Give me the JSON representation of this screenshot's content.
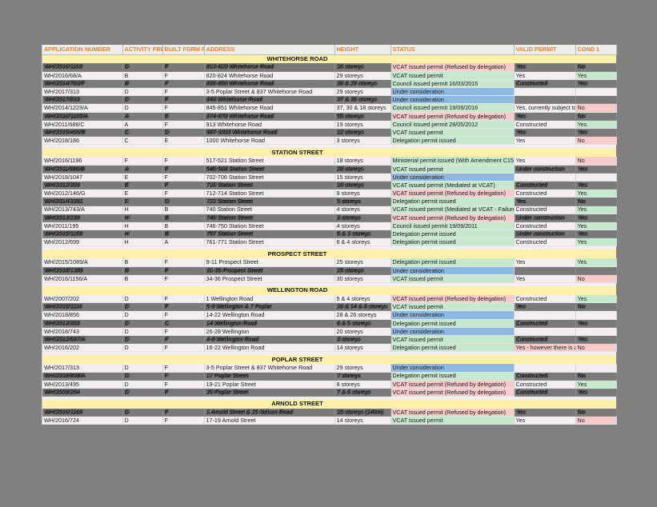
{
  "app": {
    "background_color": "#808080",
    "sheet_background": "#ffffff"
  },
  "table": {
    "headers": [
      "APPLICATION NUMBER",
      "ACTIVITY PRE",
      "BUILT FORM PR",
      "ADDRESS",
      "HEIGHT",
      "STATUS",
      "VALID PERMIT",
      "COND 1"
    ],
    "colors": {
      "header_text": "#ED7D31",
      "header_fill": "#ECEEE9",
      "section_fill": "#FDF0A8",
      "green": "#C6E8CD",
      "pink": "#F8CBCB",
      "blue": "#8DB9E2",
      "row_fill": "#F3EEF1",
      "glitch_fill": "#7A7A7A"
    },
    "sections": [
      {
        "name": "WHITEHORSE ROAD",
        "rows": [
          {
            "app": "WH/2016/1109",
            "activity": "D",
            "built": "F",
            "address": "813-829 Whitehorse Road",
            "height": "16 storeys",
            "status": "VCAT issued permit (Refused by delegation)",
            "status_color": "pink",
            "valid": "Yes",
            "valid_color": "plain",
            "cond": "No",
            "cond_color": "pink",
            "glitch": true
          },
          {
            "app": "WH/2016/68/A",
            "activity": "B",
            "built": "F",
            "address": "820-824 Whitehorse Road",
            "height": "29 storeys",
            "status": "VCAT issued permit",
            "status_color": "green",
            "valid": "Yes",
            "valid_color": "plain",
            "cond": "Yes",
            "cond_color": "green",
            "glitch": false
          },
          {
            "app": "WH/2014/763/F",
            "activity": "B",
            "built": "F",
            "address": "836-850 Whitehorse Road",
            "height": "36 & 29 storeys",
            "status": "Council issued permit 16/03/2015",
            "status_color": "green",
            "valid": "Constructed",
            "valid_color": "plain",
            "cond": "Yes",
            "cond_color": "green",
            "glitch": true
          },
          {
            "app": "WH/2017/313",
            "activity": "D",
            "built": "F",
            "address": "3-5 Poplar Street & 837 Whitehorse Road",
            "height": "29 storeys",
            "status": "Under consideration",
            "status_color": "blue",
            "valid": "",
            "valid_color": "plain",
            "cond": "",
            "cond_color": "plain",
            "glitch": false
          },
          {
            "app": "WH/2017/819",
            "activity": "D",
            "built": "F",
            "address": "843 Whitehorse Road",
            "height": "37 & 36 storeys",
            "status": "Under consideration",
            "status_color": "blue",
            "valid": "",
            "valid_color": "plain",
            "cond": "",
            "cond_color": "plain",
            "glitch": true
          },
          {
            "app": "WH/2014/1223/A",
            "activity": "D",
            "built": "F",
            "address": "845-851 Whitehorse Road",
            "height": "37, 30 & 18 storeys",
            "status": "Council issued permit 19/09/2016",
            "status_color": "green",
            "valid": "Yes, currently subject to a",
            "valid_color": "plain",
            "cond": "No",
            "cond_color": "pink",
            "glitch": false
          },
          {
            "app": "WH/2016/1105/A",
            "activity": "A",
            "built": "E",
            "address": "874-878 Whitehorse Road",
            "height": "55 storeys",
            "status": "VCAT issued permit (Refused by delegation)",
            "status_color": "pink",
            "valid": "Yes",
            "valid_color": "plain",
            "cond": "No",
            "cond_color": "pink",
            "glitch": true
          },
          {
            "app": "WH/2011/688/C",
            "activity": "A",
            "built": "F",
            "address": "913 Whitehorse Road",
            "height": "19 storeys",
            "status": "Council issued permit 28/05/2012",
            "status_color": "green",
            "valid": "Constructed",
            "valid_color": "plain",
            "cond": "Yes",
            "cond_color": "green",
            "glitch": false
          },
          {
            "app": "WH/2015/406/B",
            "activity": "C",
            "built": "D",
            "address": "987-1003 Whitehorse Road",
            "height": "12 storeys",
            "status": "VCAT issued permit",
            "status_color": "green",
            "valid": "Yes",
            "valid_color": "plain",
            "cond": "Yes",
            "cond_color": "green",
            "glitch": true
          },
          {
            "app": "WH/2018/186",
            "activity": "C",
            "built": "E",
            "address": "1000 Whitehorse Road",
            "height": "3 storeys",
            "status": "Delegation permit issued",
            "status_color": "green",
            "valid": "Yes",
            "valid_color": "plain",
            "cond": "No",
            "cond_color": "pink",
            "glitch": false
          }
        ]
      },
      {
        "name": "STATION STREET",
        "rows": [
          {
            "app": "WH/2016/1196",
            "activity": "F",
            "built": "F",
            "address": "517-521 Station Street",
            "height": "18 storeys",
            "status": "Ministerial permit issued (With Amendment C15",
            "status_color": "green",
            "valid": "Yes",
            "valid_color": "plain",
            "cond": "No",
            "cond_color": "pink",
            "glitch": false
          },
          {
            "app": "WH/2011/986/B",
            "activity": "A",
            "built": "F",
            "address": "545-568 Station Street",
            "height": "28 storeys",
            "status": "VCAT issued permit",
            "status_color": "green",
            "valid": "Under construction",
            "valid_color": "plain",
            "cond": "Yes",
            "cond_color": "green",
            "glitch": true
          },
          {
            "app": "WH/2018/1047",
            "activity": "E",
            "built": "F",
            "address": "702-706 Station Street",
            "height": "15 storeys",
            "status": "Under consideration",
            "status_color": "blue",
            "valid": "",
            "valid_color": "plain",
            "cond": "",
            "cond_color": "plain",
            "glitch": false
          },
          {
            "app": "WH/2012/309",
            "activity": "E",
            "built": "F",
            "address": "710 Station Street",
            "height": "10 storeys",
            "status": "VCAT issued permit (Mediated at VCAT)",
            "status_color": "green",
            "valid": "Constructed",
            "valid_color": "plain",
            "cond": "Yes",
            "cond_color": "green",
            "glitch": true
          },
          {
            "app": "WH/2012/146/G",
            "activity": "E",
            "built": "F",
            "address": "712-714 Station Street",
            "height": "9 storeys",
            "status": "VCAT issued permit (Refused by delegation)",
            "status_color": "pink",
            "valid": "Constructed",
            "valid_color": "plain",
            "cond": "Yes",
            "cond_color": "green",
            "glitch": false
          },
          {
            "app": "WH/2014/1061",
            "activity": "E",
            "built": "D",
            "address": "722 Station Street",
            "height": "5 storeys",
            "status": "Delegation permit issued",
            "status_color": "green",
            "valid": "Yes",
            "valid_color": "plain",
            "cond": "No",
            "cond_color": "pink",
            "glitch": true
          },
          {
            "app": "WH/2013/743/A",
            "activity": "H",
            "built": "B",
            "address": "740 Station Street",
            "height": "4 storeys",
            "status": "VCAT issued permit (Mediated at VCAT - Failure",
            "status_color": "green",
            "valid": "Constructed",
            "valid_color": "plain",
            "cond": "Yes",
            "cond_color": "green",
            "glitch": false
          },
          {
            "app": "WH/2013/239",
            "activity": "H",
            "built": "B",
            "address": "740 Station Street",
            "height": "3 storeys",
            "status": "VCAT issued permit (Refused by delegation)",
            "status_color": "pink",
            "valid": "Under construction",
            "valid_color": "plain",
            "cond": "Yes",
            "cond_color": "green",
            "glitch": true
          },
          {
            "app": "WH/2011/195",
            "activity": "H",
            "built": "B",
            "address": "746-750 Station Street",
            "height": "4 storeys",
            "status": "Council issued permit 19/09/2011",
            "status_color": "green",
            "valid": "Constructed",
            "valid_color": "plain",
            "cond": "Yes",
            "cond_color": "green",
            "glitch": false
          },
          {
            "app": "WH/2015/1159",
            "activity": "H",
            "built": "B",
            "address": "757 Station Street",
            "height": "5 & 3 storeys",
            "status": "Delegation permit issued",
            "status_color": "green",
            "valid": "Under construction",
            "valid_color": "plain",
            "cond": "Yes",
            "cond_color": "green",
            "glitch": true
          },
          {
            "app": "WH/2012/699",
            "activity": "H",
            "built": "A",
            "address": "761-771 Station Street",
            "height": "6 & 4 storeys",
            "status": "Delegation permit issued",
            "status_color": "green",
            "valid": "Constructed",
            "valid_color": "plain",
            "cond": "Yes",
            "cond_color": "green",
            "glitch": false
          }
        ]
      },
      {
        "name": "PROSPECT STREET",
        "rows": [
          {
            "app": "WH/2015/1089/A",
            "activity": "B",
            "built": "F",
            "address": "9-11 Prospect Street",
            "height": "25 storeys",
            "status": "Delegation permit issued",
            "status_color": "green",
            "valid": "Yes",
            "valid_color": "plain",
            "cond": "Yes",
            "cond_color": "green",
            "glitch": false
          },
          {
            "app": "WH/2018/1386",
            "activity": "B",
            "built": "F",
            "address": "31-35 Prospect Street",
            "height": "25 storeys",
            "status": "Under consideration",
            "status_color": "blue",
            "valid": "",
            "valid_color": "plain",
            "cond": "",
            "cond_color": "plain",
            "glitch": true
          },
          {
            "app": "WH/2016/1156/A",
            "activity": "B",
            "built": "F",
            "address": "34-36 Prospect Street",
            "height": "30 storeys",
            "status": "VCAT issued permit",
            "status_color": "green",
            "valid": "Yes",
            "valid_color": "plain",
            "cond": "No",
            "cond_color": "pink",
            "glitch": false
          }
        ]
      },
      {
        "name": "WELLINGTON ROAD",
        "rows": [
          {
            "app": "WH/2007/202",
            "activity": "D",
            "built": "F",
            "address": "1 Wellington Road",
            "height": "5 & 4 storeys",
            "status": "VCAT issued permit (Refused by delegation)",
            "status_color": "pink",
            "valid": "Constructed",
            "valid_color": "plain",
            "cond": "Yes",
            "cond_color": "green",
            "glitch": false
          },
          {
            "app": "WH/2015/1116",
            "activity": "D",
            "built": "F",
            "address": "5-9 Wellington & 7 Poplar",
            "height": "16 & 14 & 6 storeys",
            "status": "VCAT issued permit",
            "status_color": "green",
            "valid": "Yes",
            "valid_color": "plain",
            "cond": "No",
            "cond_color": "pink",
            "glitch": true
          },
          {
            "app": "WH/2018/856",
            "activity": "D",
            "built": "F",
            "address": "14-22 Wellington Road",
            "height": "28 & 26 storeys",
            "status": "Under consideration",
            "status_color": "blue",
            "valid": "",
            "valid_color": "plain",
            "cond": "",
            "cond_color": "plain",
            "glitch": false
          },
          {
            "app": "WH/2013/303",
            "activity": "D",
            "built": "C",
            "address": "14 Wellington Road",
            "height": "6 & 5 storeys",
            "status": "Delegation permit issued",
            "status_color": "green",
            "valid": "Constructed",
            "valid_color": "plain",
            "cond": "Yes",
            "cond_color": "green",
            "glitch": true
          },
          {
            "app": "WH/2018/743",
            "activity": "D",
            "built": "F",
            "address": "26-28 Wellington",
            "height": "20 storeys",
            "status": "Under consideration",
            "status_color": "blue",
            "valid": "",
            "valid_color": "plain",
            "cond": "",
            "cond_color": "plain",
            "glitch": false
          },
          {
            "app": "WH/2012/687/A",
            "activity": "D",
            "built": "F",
            "address": "4-8 Wellington Road",
            "height": "3 storeys",
            "status": "VCAT issued permit",
            "status_color": "green",
            "valid": "Constructed",
            "valid_color": "plain",
            "cond": "Yes",
            "cond_color": "green",
            "glitch": true
          },
          {
            "app": "WH/2016/202",
            "activity": "D",
            "built": "F",
            "address": "16-22 Wellington Road",
            "height": "14 storeys",
            "status": "Delegation permit issued",
            "status_color": "green",
            "valid": "Yes - however there is a c",
            "valid_color": "pink",
            "cond": "No",
            "cond_color": "pink",
            "glitch": false
          }
        ]
      },
      {
        "name": "POPLAR STREET",
        "rows": [
          {
            "app": "WH/2017/313",
            "activity": "D",
            "built": "F",
            "address": "3-5 Poplar Street & 837 Whitehorse Road",
            "height": "29 storeys",
            "status": "Under consideration",
            "status_color": "blue",
            "valid": "",
            "valid_color": "plain",
            "cond": "",
            "cond_color": "plain",
            "glitch": false
          },
          {
            "app": "WH/2018/858/A",
            "activity": "D",
            "built": "F",
            "address": "17 Poplar Street",
            "height": "7 storeys",
            "status": "Delegation permit issued",
            "status_color": "green",
            "valid": "Constructed",
            "valid_color": "plain",
            "cond": "No",
            "cond_color": "pink",
            "glitch": true
          },
          {
            "app": "WH/2013/495",
            "activity": "D",
            "built": "F",
            "address": "19-21 Poplar Street",
            "height": "8 storeys",
            "status": "VCAT issued permit (Refused by delegation)",
            "status_color": "pink",
            "valid": "Constructed",
            "valid_color": "plain",
            "cond": "Yes",
            "cond_color": "green",
            "glitch": false
          },
          {
            "app": "WH/2009/284",
            "activity": "D",
            "built": "F",
            "address": "20 Poplar Street",
            "height": "7 & 6 storeys",
            "status": "VCAT issued permit (Refused by delegation)",
            "status_color": "pink",
            "valid": "Constructed",
            "valid_color": "plain",
            "cond": "Yes",
            "cond_color": "green",
            "glitch": true
          }
        ]
      },
      {
        "name": "ARNOLD STREET",
        "rows": [
          {
            "app": "WH/2016/1169",
            "activity": "D",
            "built": "F",
            "address": "1 Arnold Street & 25 Nelson Road",
            "height": "15 storeys (140m)",
            "status": "VCAT issued permit (Refused by delegation)",
            "status_color": "pink",
            "valid": "Yes",
            "valid_color": "plain",
            "cond": "No",
            "cond_color": "pink",
            "glitch": true
          },
          {
            "app": "WH/2016/724",
            "activity": "D",
            "built": "F",
            "address": "17-19 Arnold Street",
            "height": "14 storeys",
            "status": "VCAT issued permit",
            "status_color": "green",
            "valid": "Yes",
            "valid_color": "plain",
            "cond": "No",
            "cond_color": "pink",
            "glitch": false
          }
        ]
      }
    ]
  }
}
